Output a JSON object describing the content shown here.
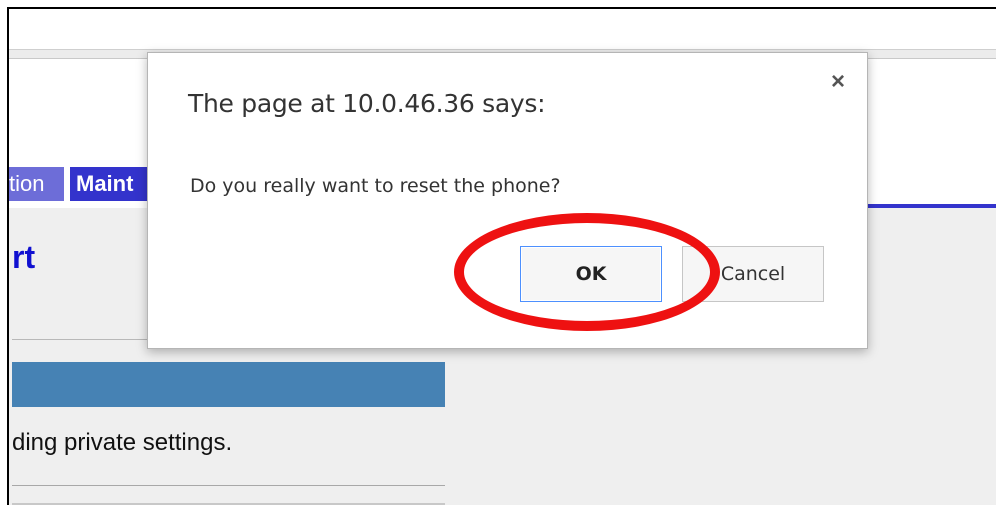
{
  "background_page": {
    "nav_tabs": [
      {
        "label": "tion"
      },
      {
        "label": "Maint"
      }
    ],
    "section_title": "rt",
    "description": "ding private settings."
  },
  "dialog": {
    "title": "The page at 10.0.46.36 says:",
    "message": "Do you really want to reset the phone?",
    "close_icon": "close-icon",
    "ok_label": "OK",
    "cancel_label": "Cancel"
  },
  "colors": {
    "nav_active": "#3333cc",
    "nav_inactive": "#6d6dd8",
    "header_bar": "#4682b4",
    "section_title": "#1010d0",
    "highlight": "#ee1111",
    "ok_border": "#4d90fe"
  }
}
